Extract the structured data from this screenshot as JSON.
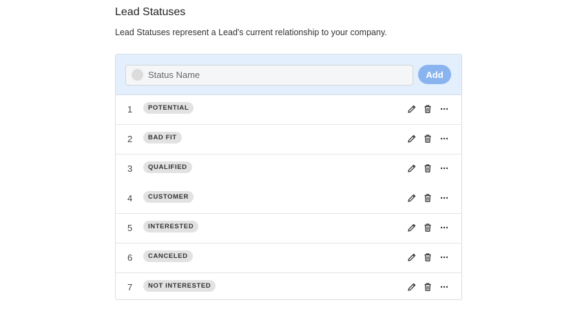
{
  "header": {
    "title": "Lead Statuses",
    "description": "Lead Statuses represent a Lead's current relationship to your company."
  },
  "add_form": {
    "placeholder": "Status Name",
    "add_label": "Add"
  },
  "colors": {
    "panel_header_bg": "#e3effc",
    "add_button_bg": "#8ab4f0",
    "badge_bg": "#e2e2e2"
  },
  "icons": {
    "edit": "pencil-icon",
    "delete": "trash-icon",
    "more": "ellipsis-icon"
  },
  "statuses": [
    {
      "index": "1",
      "label": "POTENTIAL"
    },
    {
      "index": "2",
      "label": "BAD FIT"
    },
    {
      "index": "3",
      "label": "QUALIFIED"
    },
    {
      "index": "4",
      "label": "CUSTOMER"
    },
    {
      "index": "5",
      "label": "INTERESTED"
    },
    {
      "index": "6",
      "label": "CANCELED"
    },
    {
      "index": "7",
      "label": "NOT INTERESTED"
    }
  ]
}
